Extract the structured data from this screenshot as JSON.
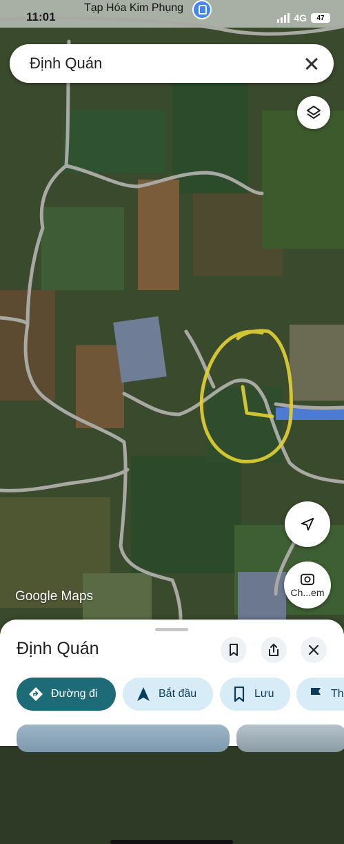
{
  "status_bar": {
    "time": "11:01",
    "place": "Tạp Hóa Kim Phụng",
    "network": "4G",
    "battery": "47"
  },
  "search": {
    "value": "Định Quán"
  },
  "map": {
    "watermark": "Google Maps",
    "lens_label": "Ch...em",
    "icons": [
      "layers-icon",
      "navigation-arrow-icon",
      "camera-lens-icon"
    ]
  },
  "sheet": {
    "title": "Định Quán",
    "icons": [
      "bookmark-icon",
      "share-icon",
      "close-icon"
    ],
    "chips": [
      {
        "label": "Đường đi",
        "icon": "directions-icon"
      },
      {
        "label": "Bắt đầu",
        "icon": "navigation-icon"
      },
      {
        "label": "Lưu",
        "icon": "bookmark-icon"
      },
      {
        "label": "Th",
        "icon": "flag-icon"
      }
    ]
  },
  "colors": {
    "primary_chip": "#1e6b78",
    "chip_bg": "#d7ecf6",
    "annotation_circle": "#e3d233"
  }
}
